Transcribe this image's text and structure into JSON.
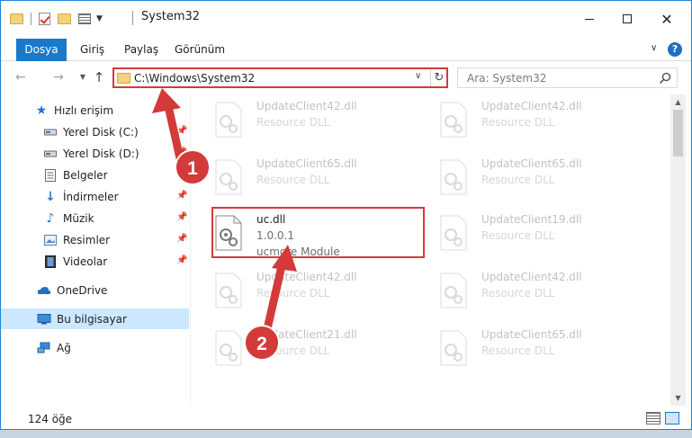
{
  "window": {
    "title": "System32",
    "minimize_icon": "minimize-icon",
    "maximize_icon": "maximize-icon",
    "close_glyph": "✕"
  },
  "ribbon": {
    "tabs": [
      {
        "label": "Dosya",
        "active": true
      },
      {
        "label": "Giriş"
      },
      {
        "label": "Paylaş"
      },
      {
        "label": "Görünüm"
      }
    ],
    "help_glyph": "?"
  },
  "address_bar": {
    "path": "C:\\Windows\\System32"
  },
  "search": {
    "placeholder": "Ara: System32"
  },
  "sidebar": {
    "items": [
      {
        "label": "Hızlı erişim",
        "icon": "star-icon"
      },
      {
        "label": "Yerel Disk (C:)",
        "icon": "drive-icon"
      },
      {
        "label": "Yerel Disk (D:)",
        "icon": "drive-icon"
      },
      {
        "label": "Belgeler",
        "icon": "documents-icon"
      },
      {
        "label": "İndirmeler",
        "icon": "download-icon"
      },
      {
        "label": "Müzik",
        "icon": "music-icon"
      },
      {
        "label": "Resimler",
        "icon": "pictures-icon"
      },
      {
        "label": "Videolar",
        "icon": "videos-icon"
      },
      {
        "label": "OneDrive",
        "icon": "cloud-icon"
      },
      {
        "label": "Bu bilgisayar",
        "icon": "computer-icon",
        "selected": true
      },
      {
        "label": "Ağ",
        "icon": "network-icon"
      }
    ]
  },
  "files": {
    "left": [
      {
        "name": "UpdateClient42.dll",
        "desc": "Resource DLL"
      },
      {
        "name": "UpdateClient65.dll",
        "desc": "Resource DLL"
      },
      {
        "name": "uc.dll",
        "version": "1.0.0.1",
        "desc": "ucmore Module",
        "highlighted": true
      },
      {
        "name": "UpdateClient42.dll",
        "desc": "Resource DLL"
      },
      {
        "name": "UpdateClient21.dll",
        "desc": "Resource DLL"
      }
    ],
    "right": [
      {
        "name": "UpdateClient42.dll",
        "desc": "Resource DLL"
      },
      {
        "name": "UpdateClient65.dll",
        "desc": "Resource DLL"
      },
      {
        "name": "UpdateClient19.dll",
        "desc": "Resource DLL"
      },
      {
        "name": "UpdateClient42.dll",
        "desc": "Resource DLL"
      },
      {
        "name": "UpdateClient65.dll",
        "desc": "Resource DLL"
      }
    ]
  },
  "status_bar": {
    "item_count": "124 öğe"
  },
  "annotations": [
    {
      "number": "1"
    },
    {
      "number": "2"
    }
  ],
  "colors": {
    "accent": "#1979ca",
    "highlight_red": "#d33a3a",
    "selection": "#cce8ff"
  }
}
